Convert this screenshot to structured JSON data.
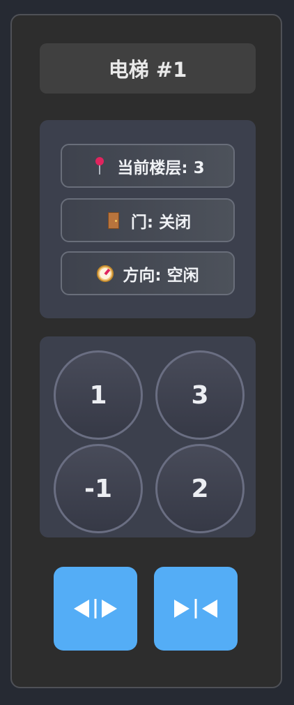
{
  "elevator": {
    "title": "电梯 #1"
  },
  "status": {
    "floor": {
      "icon": "round-pushpin-icon",
      "text": "当前楼层: 3"
    },
    "door": {
      "icon": "door-icon",
      "text": "门: 关闭"
    },
    "direction": {
      "icon": "compass-icon",
      "text": "方向: 空闲"
    }
  },
  "floor_buttons": [
    {
      "label": "1"
    },
    {
      "label": "3"
    },
    {
      "label": "-1"
    },
    {
      "label": "2"
    }
  ],
  "door_controls": {
    "open": {
      "icon": "door-open-arrows-icon"
    },
    "close": {
      "icon": "door-close-arrows-icon"
    }
  },
  "colors": {
    "accent": "#54adf6",
    "panel": "#2d2d2d",
    "section": "#3c404d"
  }
}
